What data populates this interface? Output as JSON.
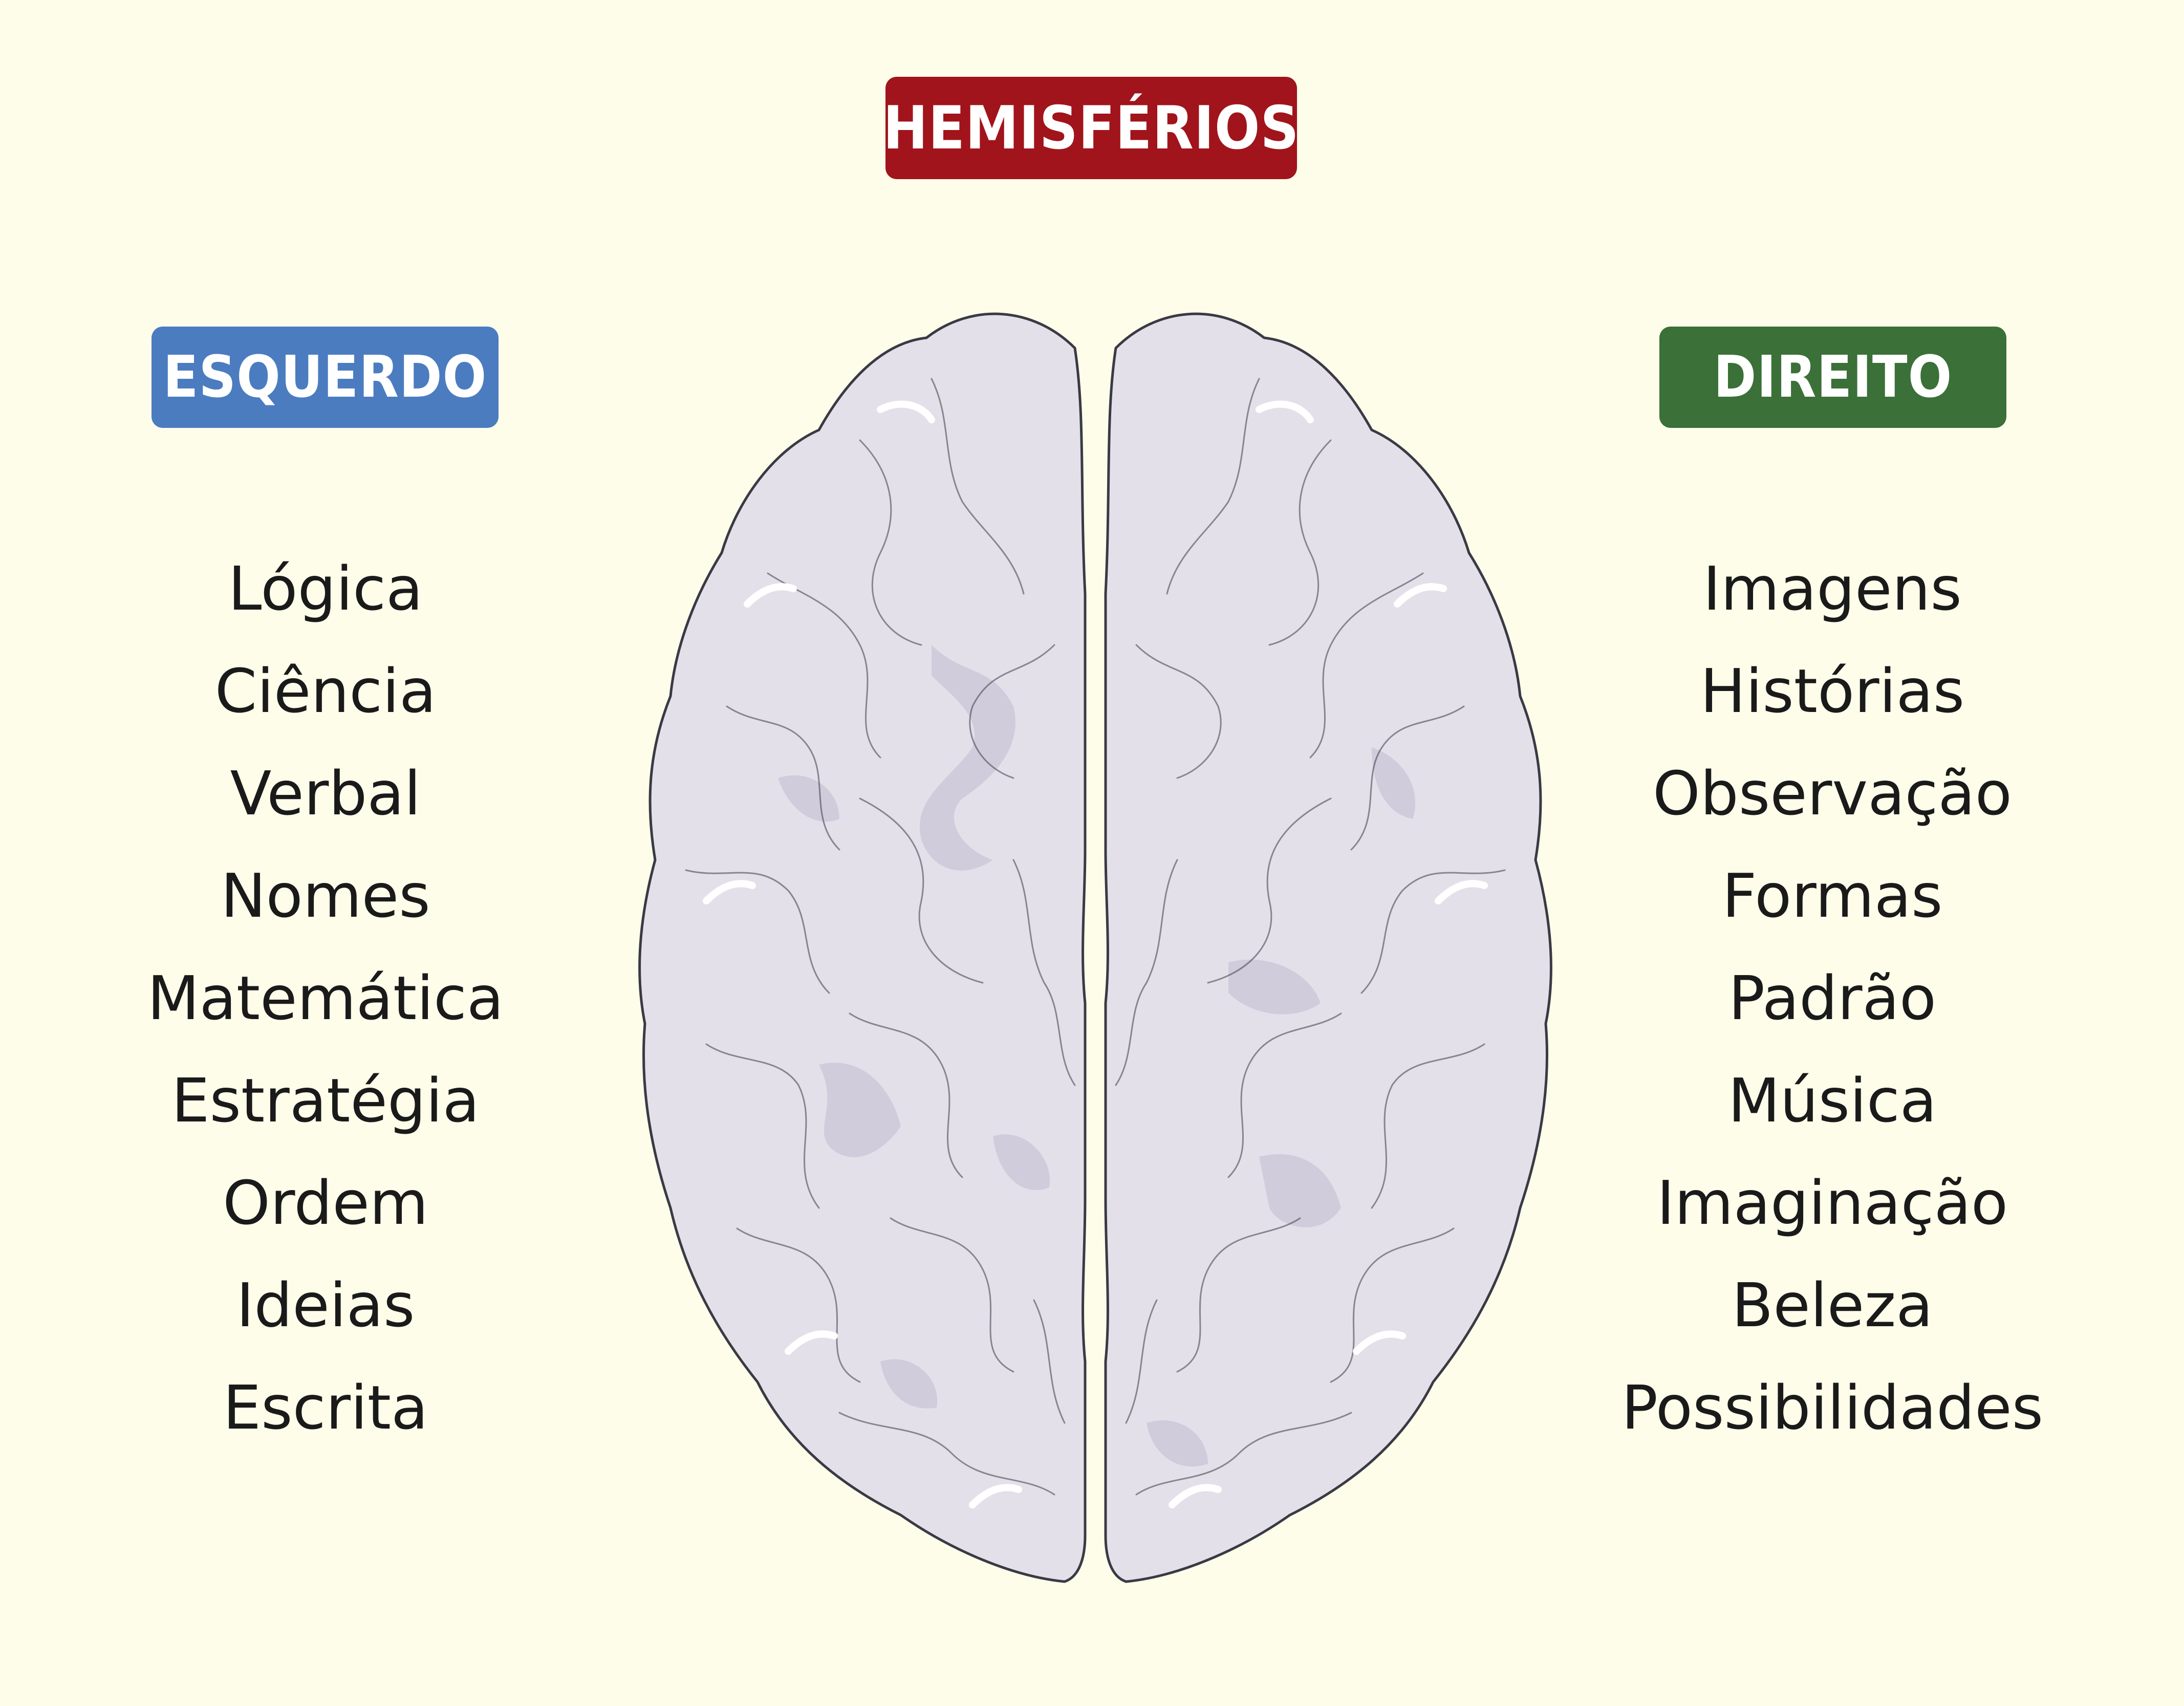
{
  "title": {
    "label": "HEMISFÉRIOS",
    "color": "#a1141b"
  },
  "left_hemisphere": {
    "label": "ESQUERDO",
    "color": "#4b7cc0",
    "items": [
      "Lógica",
      "Ciência",
      "Verbal",
      "Nomes",
      "Matemática",
      "Estratégia",
      "Ordem",
      "Ideias",
      "Escrita"
    ]
  },
  "right_hemisphere": {
    "label": "DIREITO",
    "color": "#3b7038",
    "items": [
      "Imagens",
      "Histórias",
      "Observação",
      "Formas",
      "Padrão",
      "Música",
      "Imaginação",
      "Beleza",
      "Possibilidades"
    ]
  },
  "background_color": "#fdfdea",
  "brain_colors": {
    "fill": "#e4e0ea",
    "shadow": "#c9c3d6",
    "outline": "#3a3a44",
    "highlight": "#ffffff"
  }
}
